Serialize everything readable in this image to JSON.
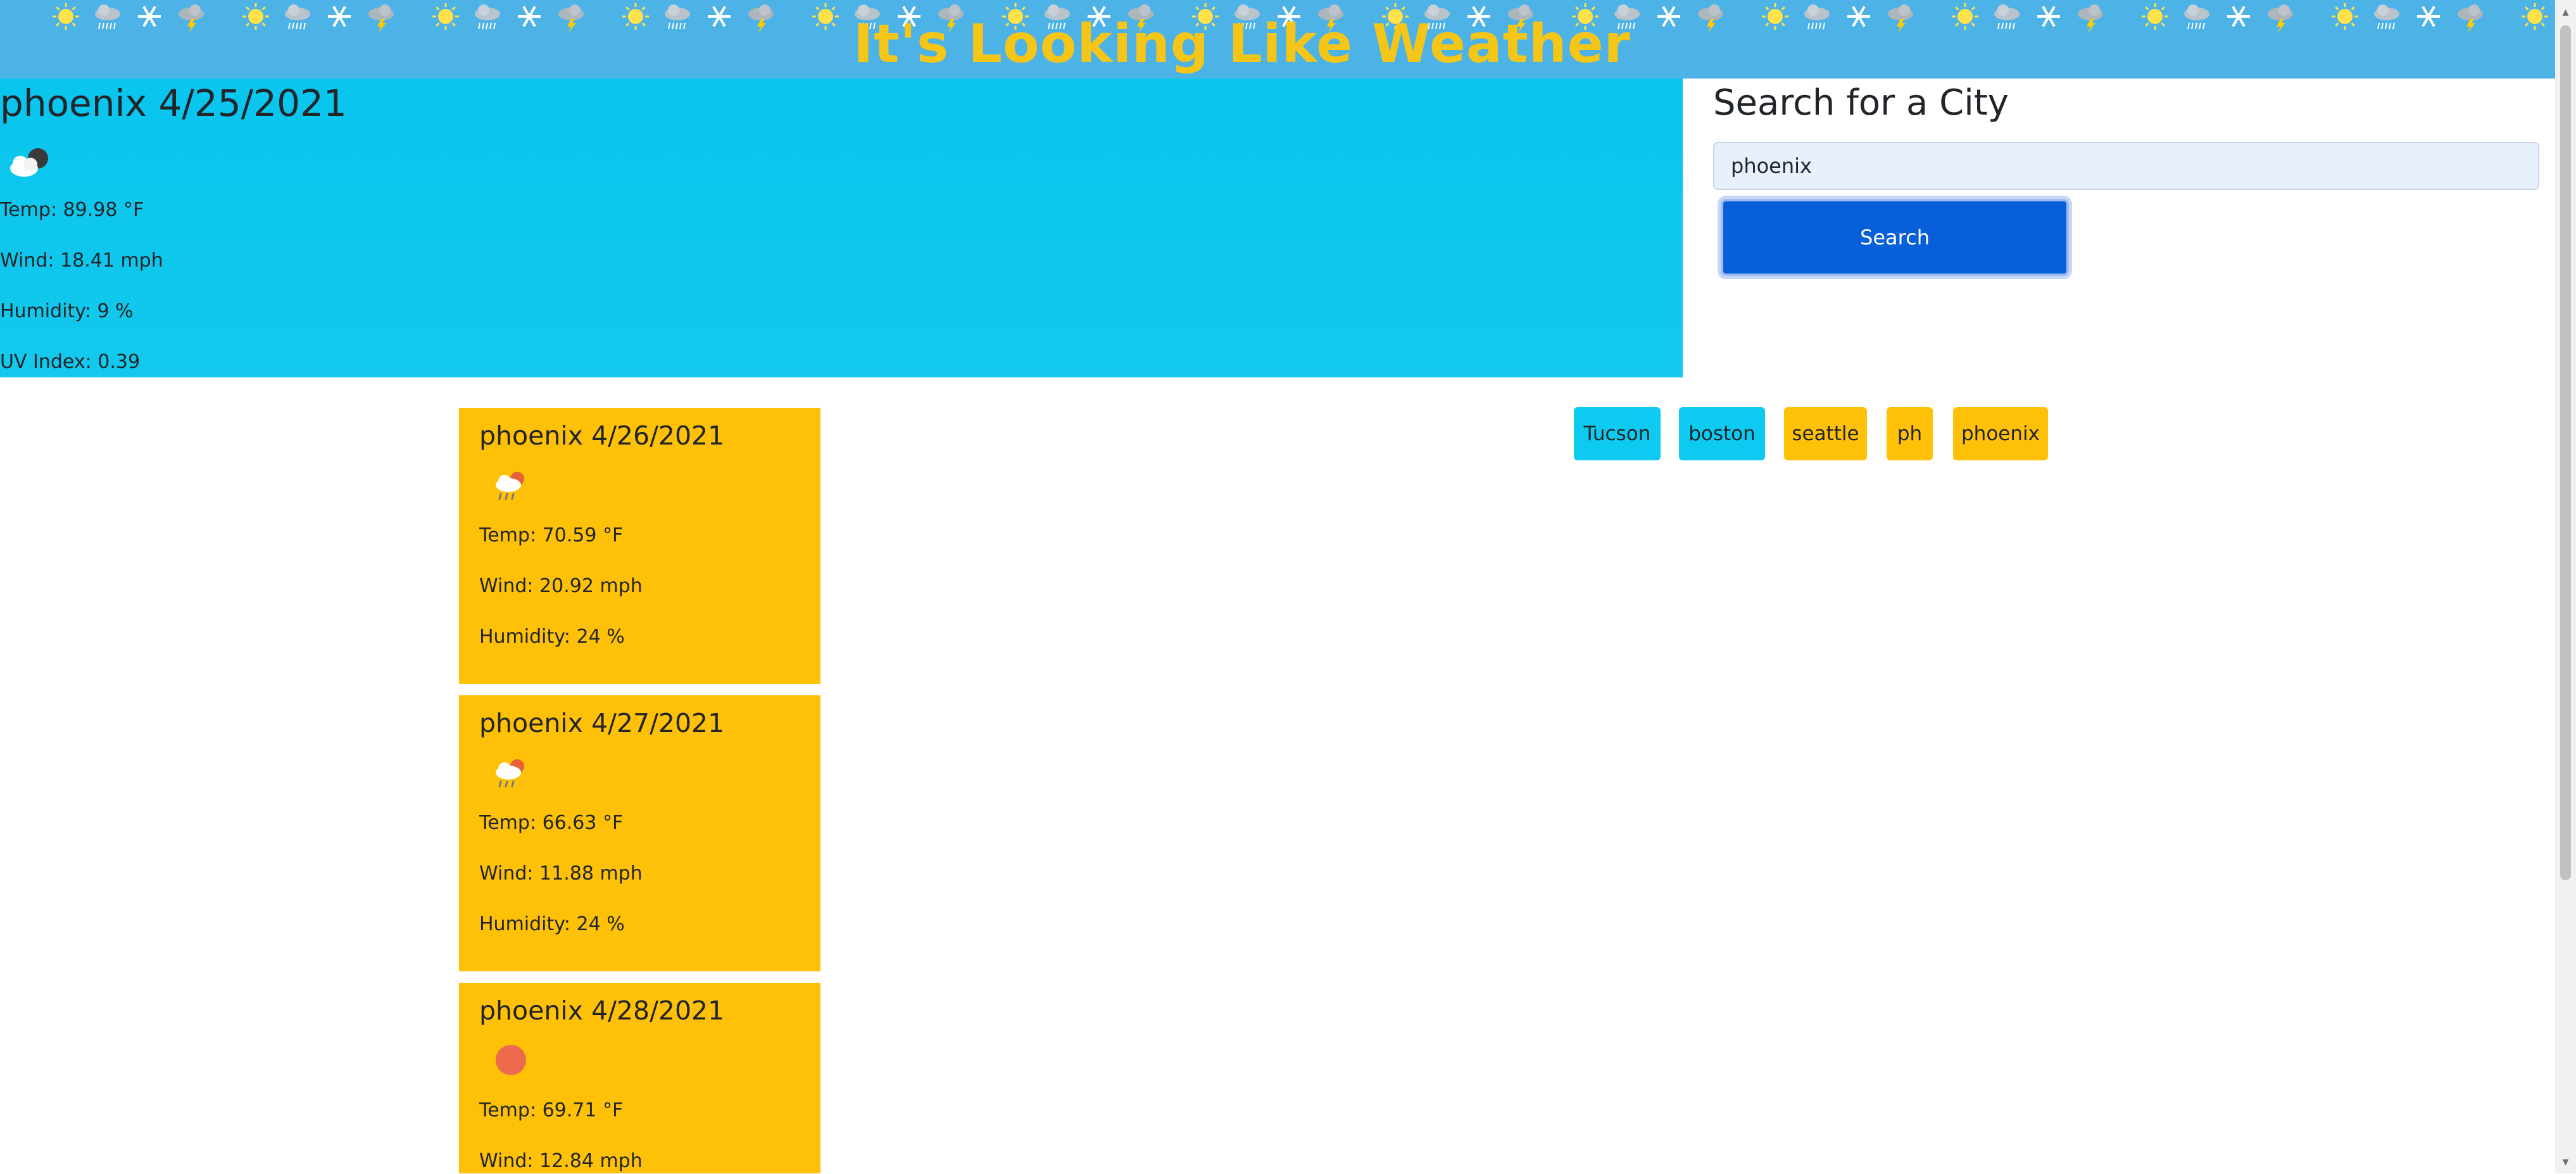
{
  "header": {
    "title": "It's Looking Like Weather",
    "icon_pattern": [
      "sun-icon",
      "rain-cloud-icon",
      "snowflake-icon",
      "storm-cloud-icon"
    ]
  },
  "current": {
    "title": "phoenix 4/25/2021",
    "icon": "cloudy-night-icon",
    "temp": "Temp: 89.98 °F",
    "wind": "Wind: 18.41 mph",
    "humidity": "Humidity: 9 %",
    "uv": "UV Index: 0.39"
  },
  "search": {
    "title": "Search for a City",
    "value": "phoenix",
    "button_label": "Search"
  },
  "history": [
    "Tucson",
    "boston",
    "seattle",
    "ph",
    "phoenix"
  ],
  "forecast": [
    {
      "title": "phoenix 4/26/2021",
      "icon": "rain-cloud-icon",
      "temp": "Temp: 70.59 °F",
      "wind": "Wind: 20.92 mph",
      "humidity": "Humidity: 24 %"
    },
    {
      "title": "phoenix 4/27/2021",
      "icon": "rain-cloud-icon",
      "temp": "Temp: 66.63 °F",
      "wind": "Wind: 11.88 mph",
      "humidity": "Humidity: 24 %"
    },
    {
      "title": "phoenix 4/28/2021",
      "icon": "sun-icon",
      "temp": "Temp: 69.71 °F",
      "wind": "Wind: 12.84 mph"
    }
  ],
  "colors": {
    "banner": "#4db3e6",
    "title": "#f5c518",
    "current_panel": "#09c6ee",
    "card": "#ffc107",
    "button": "#0760da",
    "chip_blue": "#0dcaf0"
  }
}
